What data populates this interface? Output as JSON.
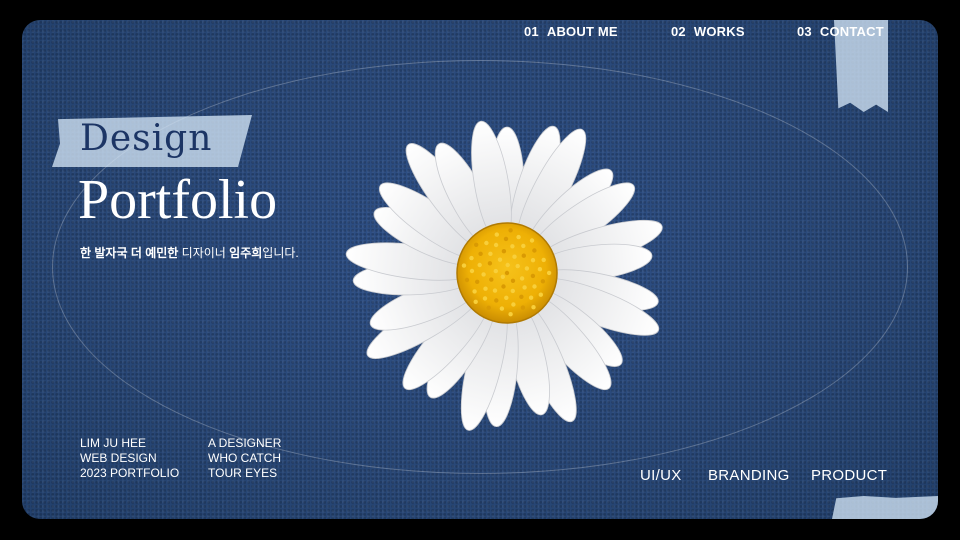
{
  "nav": {
    "items": [
      {
        "num": "01",
        "label": "ABOUT ME"
      },
      {
        "num": "02",
        "label": "WORKS"
      },
      {
        "num": "03",
        "label": "CONTACT"
      }
    ]
  },
  "hero": {
    "title_top": "Design",
    "title_main": "Portfolio",
    "tagline": {
      "part1": "한 발자국 더 예민한",
      "part2": " 디자이너 ",
      "part3": "임주희",
      "part4": "입니다."
    }
  },
  "info_left": {
    "lines": [
      "LIM JU HEE",
      "WEB DESIGN",
      "2023 PORTFOLIO"
    ]
  },
  "info_right": {
    "lines": [
      "A DESIGNER",
      "WHO CATCH",
      "TOUR EYES"
    ]
  },
  "categories": [
    "UI/UX",
    "BRANDING",
    "PRODUCT"
  ],
  "image": {
    "icon": "daisy-flower-image"
  },
  "colors": {
    "background": "#294878",
    "tape": "#d2e4f5",
    "text": "#ffffff",
    "title_dark": "#1c3565"
  }
}
